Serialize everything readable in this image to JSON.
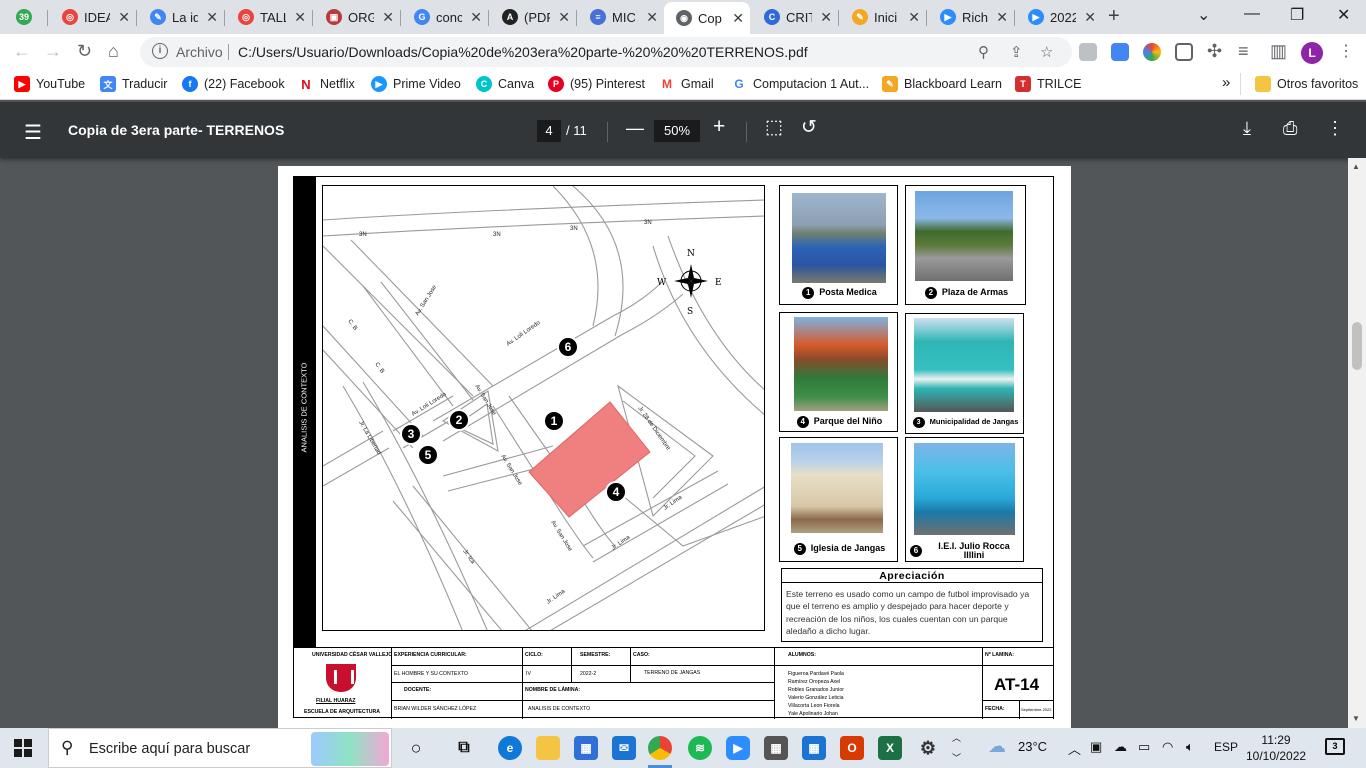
{
  "tabs": [
    {
      "label": "39",
      "color": "#34a853",
      "glyph": "39"
    },
    {
      "label": "IDEA",
      "color": "#e8453c",
      "glyph": "◎"
    },
    {
      "label": "La id",
      "color": "#4285f4",
      "glyph": "✎"
    },
    {
      "label": "TALL",
      "color": "#e8453c",
      "glyph": "◎"
    },
    {
      "label": "ORG",
      "color": "#b83a3a",
      "glyph": "▣"
    },
    {
      "label": "conc",
      "color": "#4285f4",
      "glyph": "G"
    },
    {
      "label": "(PDF",
      "color": "#222222",
      "glyph": "A"
    },
    {
      "label": "MIC",
      "color": "#4a6fd8",
      "glyph": "≡"
    },
    {
      "label": "Cop",
      "color": "#5f6368",
      "glyph": "◉"
    },
    {
      "label": "CRIT",
      "color": "#2f6ad8",
      "glyph": "C"
    },
    {
      "label": "Inici",
      "color": "#f5a623",
      "glyph": "✎"
    },
    {
      "label": "Rich",
      "color": "#2d8cff",
      "glyph": "▶"
    },
    {
      "label": "2022",
      "color": "#2d8cff",
      "glyph": "▶"
    }
  ],
  "address": {
    "prefix": "Archivo",
    "url": "C:/Users/Usuario/Downloads/Copia%20de%203era%20parte-%20%20%20TERRENOS.pdf",
    "profile_initial": "L"
  },
  "bookmarks": [
    {
      "label": "YouTube",
      "color": "#ff0000",
      "glyph": "▶"
    },
    {
      "label": "Traducir",
      "color": "#4285f4",
      "glyph": "文"
    },
    {
      "label": "(22) Facebook",
      "color": "#1877f2",
      "glyph": "f"
    },
    {
      "label": "Netflix",
      "color": "#e50914",
      "glyph": "N"
    },
    {
      "label": "Prime Video",
      "color": "#1a98ff",
      "glyph": "▶"
    },
    {
      "label": "Canva",
      "color": "#00c4cc",
      "glyph": "C"
    },
    {
      "label": "(95) Pinterest",
      "color": "#e60023",
      "glyph": "P"
    },
    {
      "label": "Gmail",
      "color": "#ea4335",
      "glyph": "M"
    },
    {
      "label": "Computacion 1 Aut...",
      "color": "#4285f4",
      "glyph": "G"
    },
    {
      "label": "Blackboard Learn",
      "color": "#f5a623",
      "glyph": "✎"
    },
    {
      "label": "TRILCE",
      "color": "#d32f2f",
      "glyph": "T"
    }
  ],
  "bookmarks_more": "»",
  "bookmarks_other": "Otros favoritos",
  "pdf": {
    "title": "Copia de 3era parte- TERRENOS",
    "page_current": "4",
    "page_total": "/ 11",
    "zoom": "50%"
  },
  "sheet": {
    "side_label": "ANALISIS DE CONTEXTO",
    "compass": {
      "n": "N",
      "s": "S",
      "e": "E",
      "w": "W"
    },
    "streets": [
      {
        "text": "3N"
      },
      {
        "text": "3N"
      },
      {
        "text": "3N"
      },
      {
        "text": "3N"
      },
      {
        "text": "Av. San Jose"
      },
      {
        "text": "Av. Loli Loredo"
      },
      {
        "text": "C. B"
      },
      {
        "text": "C. B"
      },
      {
        "text": "Av. Loli Loredo"
      },
      {
        "text": "Av. San Jose"
      },
      {
        "text": "Jr. La Libertad"
      },
      {
        "text": "Jr. 28 de Diciembre"
      },
      {
        "text": "Av. San Jose"
      },
      {
        "text": "Av. San Jose"
      },
      {
        "text": "Jr. Lima"
      },
      {
        "text": "Jr. Lima"
      },
      {
        "text": "Jr. Ica"
      },
      {
        "text": "Jr. Lima"
      }
    ],
    "markers": [
      "1",
      "2",
      "3",
      "4",
      "5",
      "6"
    ],
    "photos": [
      {
        "num": "1",
        "caption": "Posta Medica"
      },
      {
        "num": "2",
        "caption": "Plaza de Armas"
      },
      {
        "num": "4",
        "caption": "Parque del Niño"
      },
      {
        "num": "3",
        "caption": "Municipalidad de Jangas"
      },
      {
        "num": "5",
        "caption": "Iglesia de Jangas"
      },
      {
        "num": "6",
        "caption": "I.E.I. Julio Rocca Illlini"
      }
    ],
    "apreciacion_title": "Apreciación",
    "apreciacion_text": "Este  terreno es usado como un campo de futbol improvisado ya que el terreno es amplio y despejado para hacer deporte y recreación de los niños, los cuales cuentan con un parque aledaño a dicho lugar.",
    "titleblock": {
      "university": "UNIVERSIDAD CÉSAR VALLEJO",
      "filial": "FILIAL HUARAZ",
      "escuela": "ESCUELA DE ARQUITECTURA",
      "exp_label": "EXPERIENCIA CURRICULAR:",
      "exp_value": "EL HOMBRE Y SU CONTEXTO",
      "docente_label": "DOCENTE:",
      "docente_value": "BRIAN WILDER SÁNCHEZ LÓPEZ",
      "ciclo_label": "CICLO:",
      "ciclo_value": "IV",
      "semestre_label": "SEMESTRE:",
      "semestre_value": "2022-2",
      "caso_label": "CASO:",
      "caso_value": "TERRENO DE JANGAS",
      "lamina_label": "NOMBRE DE LÁMINA:",
      "lamina_value": "ANALISIS DE CONTEXTO",
      "alumnos_label": "ALUMNOS:",
      "alumnos": [
        "Figueroa Pardavé Paola",
        "Ramírez Oropeza Axel",
        "Robles Granados Junior",
        "Valerio González Leticia",
        "Villacorta Leon Fiorela",
        "Yale Apolinario Johan"
      ],
      "nlamina_label": "Nº LAMINA:",
      "code": "AT-14",
      "fecha_label": "FECHA:",
      "fecha_value": "Septiembre 2022"
    }
  },
  "taskbar": {
    "search_placeholder": "Escribe aquí para buscar",
    "weather": "23°C",
    "lang": "ESP",
    "time": "11:29",
    "date": "10/10/2022",
    "notif_count": "3"
  }
}
